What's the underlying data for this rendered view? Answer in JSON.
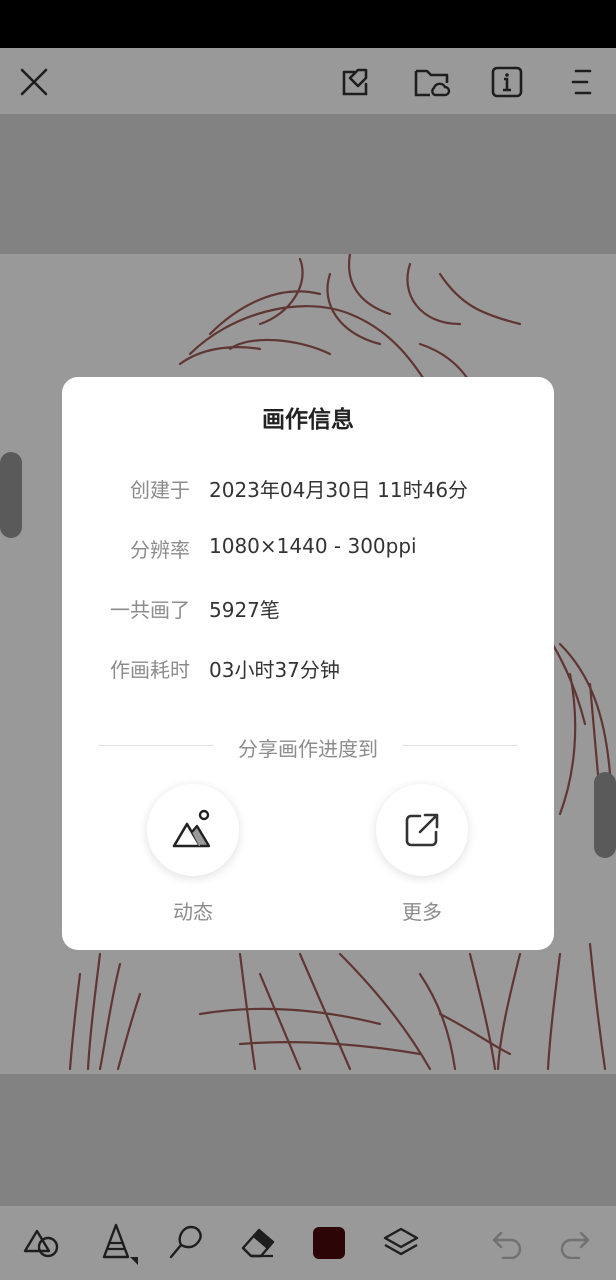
{
  "dialog": {
    "title": "画作信息",
    "rows": [
      {
        "label": "创建于",
        "value": "2023年04月30日 11时46分"
      },
      {
        "label": "分辨率",
        "value": "1080×1440 - 300ppi"
      },
      {
        "label": "一共画了",
        "value": "5927笔"
      },
      {
        "label": "作画耗时",
        "value": "03小时37分钟"
      }
    ],
    "share_heading": "分享画作进度到",
    "share_options": [
      {
        "label": "动态",
        "icon": "mountain-photo-icon"
      },
      {
        "label": "更多",
        "icon": "external-share-icon"
      }
    ]
  },
  "toolbar_top": {
    "icons": [
      "close-icon",
      "edit-tag-icon",
      "cloud-folder-icon",
      "info-icon",
      "menu-icon"
    ]
  },
  "toolbar_bottom": {
    "icons": [
      "shapes-icon",
      "brush-tool-icon",
      "smudge-tool-icon",
      "eraser-icon",
      "color-swatch",
      "layers-icon",
      "undo-icon",
      "redo-icon"
    ],
    "current_color": "#4a0a0a"
  },
  "colors": {
    "sketch_line": "#a05a55",
    "overlay": "rgba(0,0,0,0.40)"
  }
}
